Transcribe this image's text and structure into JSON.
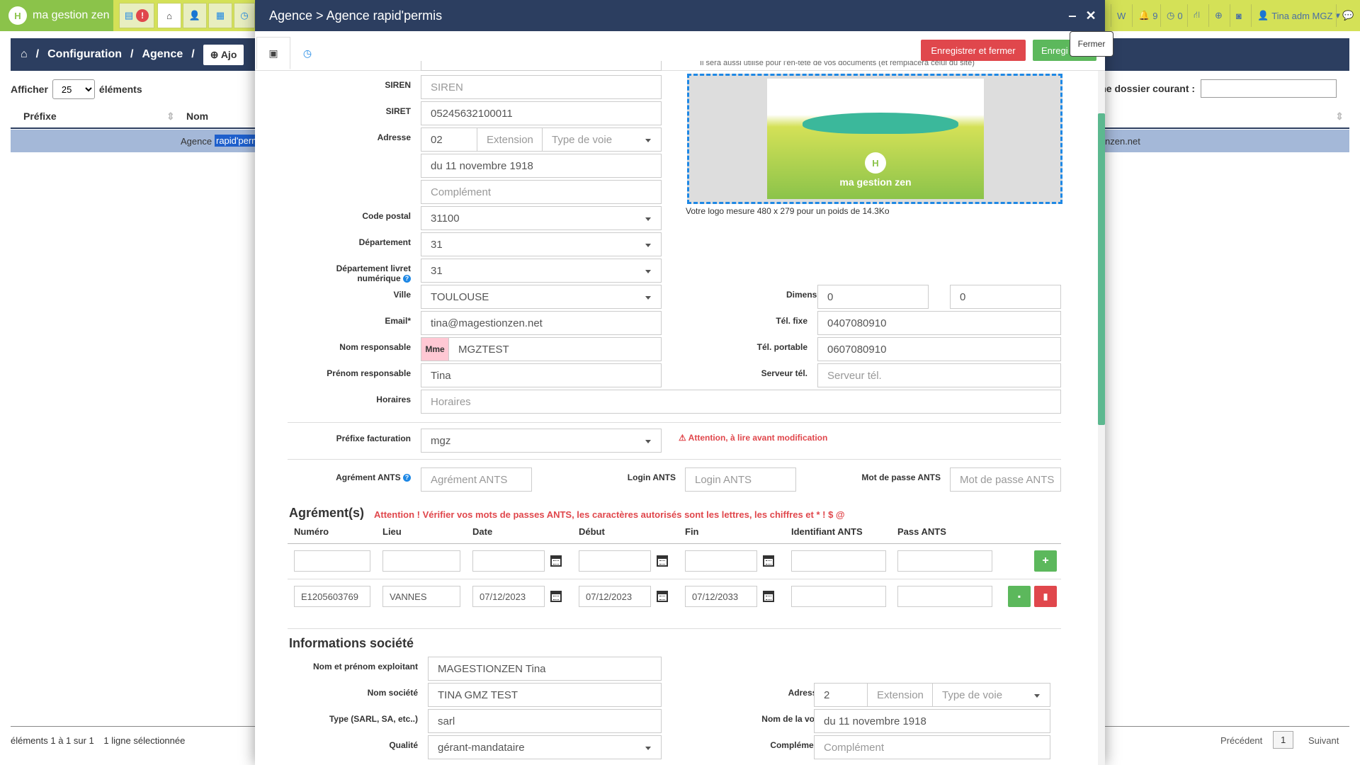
{
  "topbar": {
    "brand": "ma gestion zen",
    "right_items": [
      "W",
      "9",
      "0",
      "Tina adm MGZ"
    ]
  },
  "background": {
    "breadcrumb": [
      "Configuration",
      "Agence"
    ],
    "add_label": "Ajo",
    "show_label": "Afficher",
    "page_size": "25",
    "elements_label": "éléments",
    "search_label": "rche dossier courant :",
    "columns": [
      "Préfixe",
      "Nom"
    ],
    "row_text_prefix": "Agence",
    "row_text_highlight": "rapid'perm",
    "row_email_tail": "nzen.net",
    "footer_info": "éléments 1 à 1 sur 1",
    "footer_selected": "1 ligne sélectionnée",
    "prev": "Précédent",
    "page": "1",
    "next": "Suivant"
  },
  "modal": {
    "title": "Agence > Agence rapid'permis",
    "tooltip": "Fermer",
    "save_close": "Enregistrer et fermer",
    "save": "Enregi",
    "logo_note": "Il sera aussi utilisé pour l'en-tête de vos documents (et remplacera celui du site)",
    "logo_brand": "ma gestion zen",
    "logo_size_text": "Votre logo mesure 480 x 279 pour un poids de 14.3Ko"
  },
  "form": {
    "siren": {
      "label": "SIREN",
      "placeholder": "SIREN"
    },
    "siret": {
      "label": "SIRET",
      "value": "05245632100011"
    },
    "adresse": {
      "label": "Adresse",
      "num": "02",
      "ext_ph": "Extension",
      "type_ph": "Type de voie",
      "street": "du 11 novembre 1918",
      "comp_ph": "Complément"
    },
    "cp": {
      "label": "Code postal",
      "value": "31100"
    },
    "dept": {
      "label": "Département",
      "value": "31"
    },
    "dept_livret": {
      "label1": "Département livret",
      "label2": "numérique",
      "value": "31"
    },
    "ville": {
      "label": "Ville",
      "value": "TOULOUSE"
    },
    "email": {
      "label": "Email*",
      "value": "tina@magestionzen.net"
    },
    "nom_resp": {
      "label": "Nom responsable",
      "civ": "Mme",
      "value": "MGZTEST"
    },
    "prenom_resp": {
      "label": "Prénom responsable",
      "value": "Tina"
    },
    "horaires": {
      "label": "Horaires",
      "placeholder": "Horaires"
    },
    "dim_logo": {
      "label": "Dimension logo",
      "w": "0",
      "h": "0"
    },
    "tel_fixe": {
      "label": "Tél. fixe",
      "value": "0407080910"
    },
    "tel_port": {
      "label": "Tél. portable",
      "value": "0607080910"
    },
    "serveur": {
      "label": "Serveur tél.",
      "placeholder": "Serveur tél."
    },
    "prefixe": {
      "label": "Préfixe facturation",
      "value": "mgz",
      "warn": "Attention, à lire avant modification"
    },
    "agrement_ants": {
      "label": "Agrément ANTS",
      "placeholder": "Agrément ANTS"
    },
    "login_ants": {
      "label": "Login ANTS",
      "placeholder": "Login ANTS"
    },
    "mdp_ants": {
      "label": "Mot de passe ANTS",
      "placeholder": "Mot de passe ANTS"
    }
  },
  "agrements": {
    "title": "Agrément(s)",
    "warning": "Attention ! Vérifier vos mots de passes ANTS, les caractères autorisés sont les lettres, les chiffres et * ! $ @",
    "columns": [
      "Numéro",
      "Lieu",
      "Date",
      "Début",
      "Fin",
      "Identifiant ANTS",
      "Pass ANTS"
    ],
    "row": {
      "numero": "E1205603769",
      "lieu": "VANNES",
      "date": "07/12/2023",
      "debut": "07/12/2023",
      "fin": "07/12/2033"
    }
  },
  "societe": {
    "title": "Informations société",
    "exploitant": {
      "label": "Nom et prénom exploitant",
      "value": "MAGESTIONZEN Tina"
    },
    "nom": {
      "label": "Nom société",
      "value": "TINA GMZ TEST"
    },
    "type": {
      "label": "Type (SARL, SA, etc..)",
      "value": "sarl"
    },
    "qualite": {
      "label": "Qualité",
      "value": "gérant-mandataire"
    },
    "adresse": {
      "label": "Adresse",
      "num": "2",
      "ext_ph": "Extension",
      "type_ph": "Type de voie"
    },
    "voie": {
      "label": "Nom de la voie",
      "value": "du 11 novembre 1918"
    },
    "comp": {
      "label": "Complément",
      "placeholder": "Complément"
    }
  }
}
